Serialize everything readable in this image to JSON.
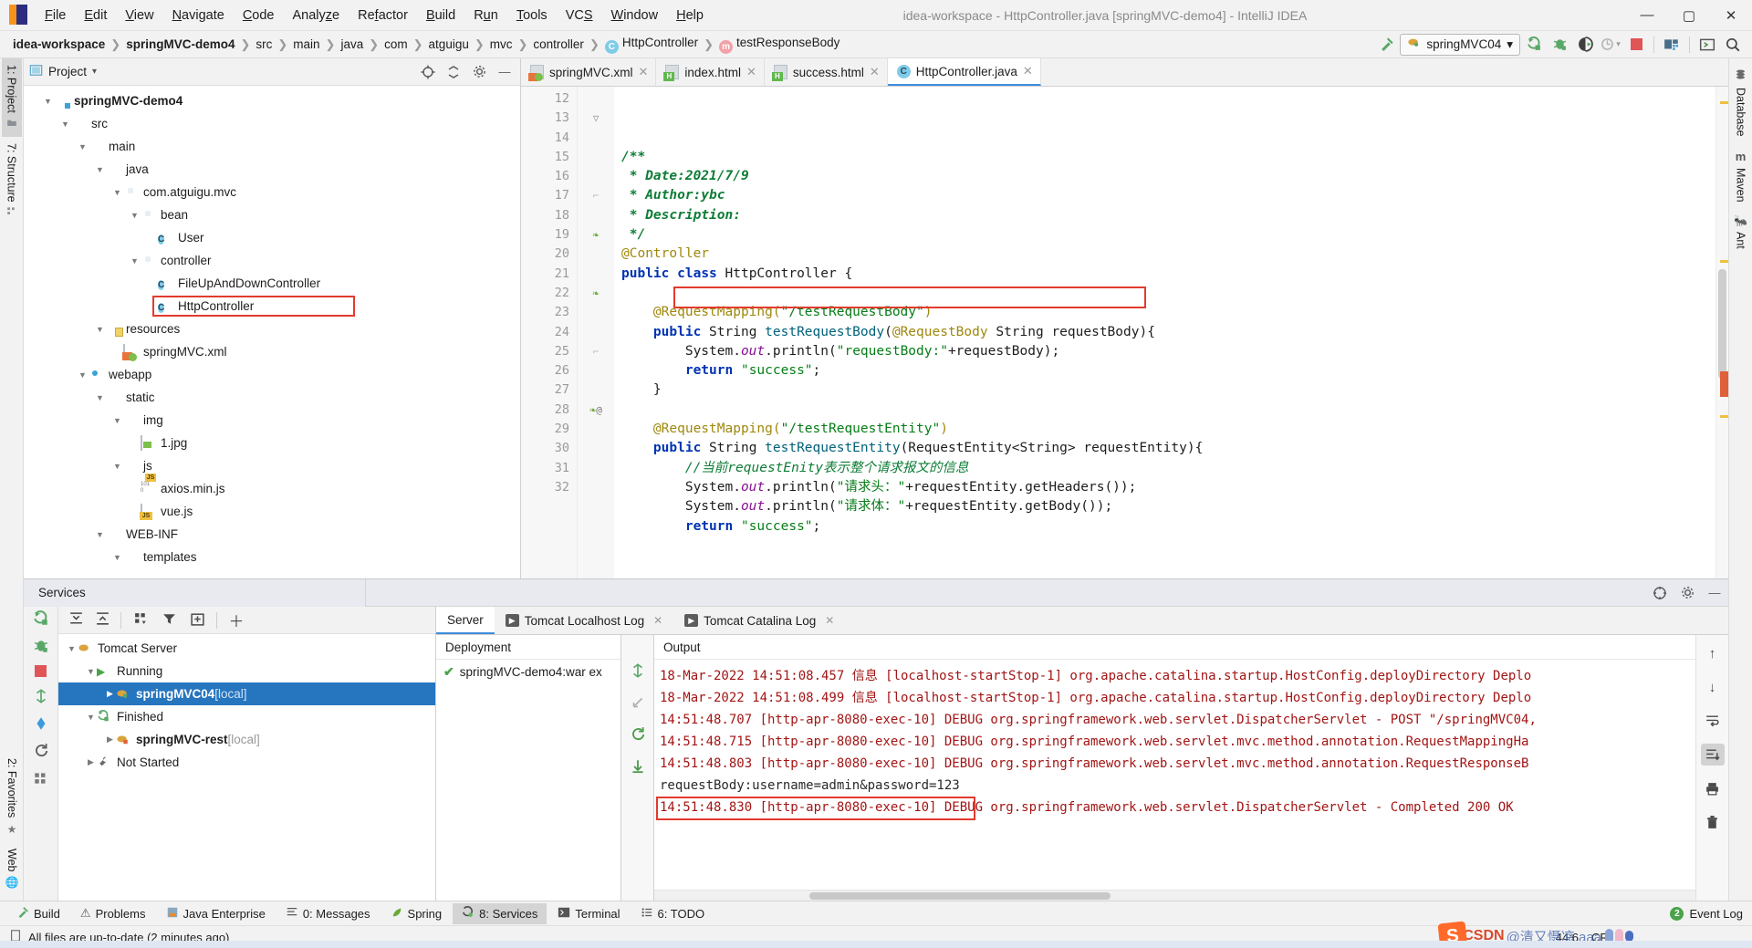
{
  "window": {
    "title": "idea-workspace - HttpController.java [springMVC-demo4] - IntelliJ IDEA",
    "minimize": "—",
    "maximize": "▢",
    "close": "✕"
  },
  "menubar": {
    "items": [
      "File",
      "Edit",
      "View",
      "Navigate",
      "Code",
      "Analyze",
      "Refactor",
      "Build",
      "Run",
      "Tools",
      "VCS",
      "Window",
      "Help"
    ]
  },
  "breadcrumb": {
    "items": [
      {
        "label": "idea-workspace",
        "bold": true,
        "icon": ""
      },
      {
        "label": "springMVC-demo4",
        "bold": true,
        "icon": ""
      },
      {
        "label": "src",
        "bold": false,
        "icon": ""
      },
      {
        "label": "main",
        "bold": false,
        "icon": ""
      },
      {
        "label": "java",
        "bold": false,
        "icon": ""
      },
      {
        "label": "com",
        "bold": false,
        "icon": ""
      },
      {
        "label": "atguigu",
        "bold": false,
        "icon": ""
      },
      {
        "label": "mvc",
        "bold": false,
        "icon": ""
      },
      {
        "label": "controller",
        "bold": false,
        "icon": ""
      },
      {
        "label": "HttpController",
        "bold": false,
        "icon": "C"
      },
      {
        "label": "testResponseBody",
        "bold": false,
        "icon": "m"
      }
    ],
    "separator": "〉"
  },
  "toolbar": {
    "run_config": "springMVC04",
    "dropdown_arrow": "▾",
    "icons": [
      "hammer-icon",
      "run-icon",
      "debug-icon",
      "run-coverage-icon",
      "profile-icon",
      "stop-icon",
      "project-structure-icon",
      "terminal-icon",
      "search-everywhere-icon"
    ]
  },
  "left_strip": {
    "tabs": [
      {
        "label": "1: Project",
        "active": true
      },
      {
        "label": "7: Structure",
        "active": false
      }
    ],
    "bottom_tabs": [
      {
        "label": "2: Favorites"
      },
      {
        "label": "Web"
      }
    ]
  },
  "right_strip": {
    "tabs": [
      "Database",
      "Maven",
      "Ant"
    ]
  },
  "project": {
    "header_title": "Project",
    "header_arrow": "▾",
    "tree": [
      {
        "depth": 0,
        "arrow": "▼",
        "icon": "module",
        "label": "springMVC-demo4",
        "bold": true,
        "boxed": false
      },
      {
        "depth": 1,
        "arrow": "▼",
        "icon": "folder",
        "label": "src",
        "bold": false,
        "boxed": false
      },
      {
        "depth": 2,
        "arrow": "▼",
        "icon": "folder",
        "label": "main",
        "bold": false,
        "boxed": false
      },
      {
        "depth": 3,
        "arrow": "▼",
        "icon": "folder-blue",
        "label": "java",
        "bold": false,
        "boxed": false
      },
      {
        "depth": 4,
        "arrow": "▼",
        "icon": "package",
        "label": "com.atguigu.mvc",
        "bold": false,
        "boxed": false
      },
      {
        "depth": 5,
        "arrow": "▼",
        "icon": "package",
        "label": "bean",
        "bold": false,
        "boxed": false
      },
      {
        "depth": 6,
        "arrow": "",
        "icon": "class",
        "label": "User",
        "bold": false,
        "boxed": false
      },
      {
        "depth": 5,
        "arrow": "▼",
        "icon": "package",
        "label": "controller",
        "bold": false,
        "boxed": false
      },
      {
        "depth": 6,
        "arrow": "",
        "icon": "class",
        "label": "FileUpAndDownController",
        "bold": false,
        "boxed": false
      },
      {
        "depth": 6,
        "arrow": "",
        "icon": "class",
        "label": "HttpController",
        "bold": false,
        "boxed": true
      },
      {
        "depth": 3,
        "arrow": "▼",
        "icon": "folder-res",
        "label": "resources",
        "bold": false,
        "boxed": false
      },
      {
        "depth": 4,
        "arrow": "",
        "icon": "xmlfile",
        "label": "springMVC.xml",
        "bold": false,
        "boxed": false
      },
      {
        "depth": 2,
        "arrow": "▼",
        "icon": "webapp",
        "label": "webapp",
        "bold": false,
        "boxed": false
      },
      {
        "depth": 3,
        "arrow": "▼",
        "icon": "folder",
        "label": "static",
        "bold": false,
        "boxed": false
      },
      {
        "depth": 4,
        "arrow": "▼",
        "icon": "folder",
        "label": "img",
        "bold": false,
        "boxed": false
      },
      {
        "depth": 5,
        "arrow": "",
        "icon": "imgfile",
        "label": "1.jpg",
        "bold": false,
        "boxed": false
      },
      {
        "depth": 4,
        "arrow": "▼",
        "icon": "folder",
        "label": "js",
        "bold": false,
        "boxed": false
      },
      {
        "depth": 5,
        "arrow": "",
        "icon": "jsmin",
        "label": "axios.min.js",
        "bold": false,
        "boxed": false
      },
      {
        "depth": 5,
        "arrow": "",
        "icon": "jsfile",
        "label": "vue.js",
        "bold": false,
        "boxed": false
      },
      {
        "depth": 3,
        "arrow": "▼",
        "icon": "folder",
        "label": "WEB-INF",
        "bold": false,
        "boxed": false
      },
      {
        "depth": 4,
        "arrow": "▼",
        "icon": "folder",
        "label": "templates",
        "bold": false,
        "boxed": false
      }
    ]
  },
  "editor": {
    "tabs": [
      {
        "label": "springMVC.xml",
        "icon": "xml",
        "active": false,
        "close": "✕"
      },
      {
        "label": "index.html",
        "icon": "html",
        "active": false,
        "close": "✕"
      },
      {
        "label": "success.html",
        "icon": "html",
        "active": false,
        "close": "✕"
      },
      {
        "label": "HttpController.java",
        "icon": "java",
        "active": true,
        "close": "✕"
      }
    ],
    "first_line_number": 12,
    "lines": [
      {
        "n": 12,
        "mark": "",
        "tokens": []
      },
      {
        "n": 13,
        "mark": "fold-doc",
        "tokens": [
          {
            "t": "/**",
            "c": "jd"
          }
        ]
      },
      {
        "n": 14,
        "mark": "",
        "tokens": [
          {
            "t": " * Date:2021/7/9",
            "c": "jd"
          }
        ]
      },
      {
        "n": 15,
        "mark": "",
        "tokens": [
          {
            "t": " * Author:ybc",
            "c": "jd"
          }
        ]
      },
      {
        "n": 16,
        "mark": "",
        "tokens": [
          {
            "t": " * Description:",
            "c": "jd"
          }
        ]
      },
      {
        "n": 17,
        "mark": "fold-end",
        "tokens": [
          {
            "t": " */",
            "c": "jd"
          }
        ]
      },
      {
        "n": 18,
        "mark": "",
        "tokens": [
          {
            "t": "@Controller",
            "c": "ann"
          }
        ]
      },
      {
        "n": 19,
        "mark": "bean",
        "tokens": [
          {
            "t": "public",
            "c": "k"
          },
          {
            "t": " ",
            "c": "plain"
          },
          {
            "t": "class",
            "c": "k"
          },
          {
            "t": " HttpController {",
            "c": "plain"
          }
        ]
      },
      {
        "n": 20,
        "mark": "",
        "tokens": []
      },
      {
        "n": 21,
        "mark": "",
        "tokens": [
          {
            "t": "    @RequestMapping(",
            "c": "ann"
          },
          {
            "t": "\"/testRequestBody\"",
            "c": "str"
          },
          {
            "t": ")",
            "c": "ann"
          }
        ]
      },
      {
        "n": 22,
        "mark": "bean",
        "tokens": [
          {
            "t": "    ",
            "c": "plain"
          },
          {
            "t": "public",
            "c": "k"
          },
          {
            "t": " String ",
            "c": "plain"
          },
          {
            "t": "testRequestBody",
            "c": "mth"
          },
          {
            "t": "(",
            "c": "plain"
          },
          {
            "t": "@RequestBody",
            "c": "ann"
          },
          {
            "t": " String requestBody){",
            "c": "plain"
          }
        ]
      },
      {
        "n": 23,
        "mark": "",
        "tokens": [
          {
            "t": "        System.",
            "c": "plain"
          },
          {
            "t": "out",
            "c": "fld"
          },
          {
            "t": ".println(",
            "c": "plain"
          },
          {
            "t": "\"requestBody:\"",
            "c": "str"
          },
          {
            "t": "+requestBody);",
            "c": "plain"
          }
        ]
      },
      {
        "n": 24,
        "mark": "",
        "tokens": [
          {
            "t": "        ",
            "c": "plain"
          },
          {
            "t": "return",
            "c": "k"
          },
          {
            "t": " ",
            "c": "plain"
          },
          {
            "t": "\"success\"",
            "c": "str"
          },
          {
            "t": ";",
            "c": "plain"
          }
        ]
      },
      {
        "n": 25,
        "mark": "fold-end",
        "tokens": [
          {
            "t": "    }",
            "c": "plain"
          }
        ]
      },
      {
        "n": 26,
        "mark": "",
        "tokens": []
      },
      {
        "n": 27,
        "mark": "",
        "tokens": [
          {
            "t": "    @RequestMapping(",
            "c": "ann"
          },
          {
            "t": "\"/testRequestEntity\"",
            "c": "str"
          },
          {
            "t": ")",
            "c": "ann"
          }
        ]
      },
      {
        "n": 28,
        "mark": "bean-at",
        "tokens": [
          {
            "t": "    ",
            "c": "plain"
          },
          {
            "t": "public",
            "c": "k"
          },
          {
            "t": " String ",
            "c": "plain"
          },
          {
            "t": "testRequestEntity",
            "c": "mth"
          },
          {
            "t": "(RequestEntity<String> requestEntity){",
            "c": "plain"
          }
        ]
      },
      {
        "n": 29,
        "mark": "",
        "tokens": [
          {
            "t": "        //当前requestEnity表示整个请求报文的信息",
            "c": "cmzh"
          }
        ]
      },
      {
        "n": 30,
        "mark": "",
        "tokens": [
          {
            "t": "        System.",
            "c": "plain"
          },
          {
            "t": "out",
            "c": "fld"
          },
          {
            "t": ".println(",
            "c": "plain"
          },
          {
            "t": "\"请求头：\"",
            "c": "str"
          },
          {
            "t": "+requestEntity.getHeaders());",
            "c": "plain"
          }
        ]
      },
      {
        "n": 31,
        "mark": "",
        "tokens": [
          {
            "t": "        System.",
            "c": "plain"
          },
          {
            "t": "out",
            "c": "fld"
          },
          {
            "t": ".println(",
            "c": "plain"
          },
          {
            "t": "\"请求体：\"",
            "c": "str"
          },
          {
            "t": "+requestEntity.getBody());",
            "c": "plain"
          }
        ]
      },
      {
        "n": 32,
        "mark": "",
        "tokens": [
          {
            "t": "        ",
            "c": "plain"
          },
          {
            "t": "return",
            "c": "k"
          },
          {
            "t": " ",
            "c": "plain"
          },
          {
            "t": "\"success\"",
            "c": "str"
          },
          {
            "t": ";",
            "c": "plain"
          }
        ]
      }
    ],
    "highlight_note": "red box around line 23 println statement"
  },
  "services": {
    "panel_title": "Services",
    "tree": [
      {
        "depth": 0,
        "arrow": "▼",
        "icon": "tomcat",
        "label": "Tomcat Server",
        "suffix": "",
        "bold": false,
        "selected": false
      },
      {
        "depth": 1,
        "arrow": "▼",
        "icon": "running",
        "label": "Running",
        "suffix": "",
        "bold": false,
        "selected": false
      },
      {
        "depth": 2,
        "arrow": "▶",
        "icon": "tomcat-run",
        "label": "springMVC04",
        "suffix": " [local]",
        "bold": true,
        "selected": true
      },
      {
        "depth": 1,
        "arrow": "▼",
        "icon": "finished",
        "label": "Finished",
        "suffix": "",
        "bold": false,
        "selected": false
      },
      {
        "depth": 2,
        "arrow": "▶",
        "icon": "tomcat-stop",
        "label": "springMVC-rest",
        "suffix": " [local]",
        "bold": true,
        "selected": false
      },
      {
        "depth": 1,
        "arrow": "▶",
        "icon": "wrench",
        "label": "Not Started",
        "suffix": "",
        "bold": false,
        "selected": false
      }
    ],
    "console_tabs": [
      {
        "label": "Server",
        "active": true,
        "has_icon": false,
        "close": ""
      },
      {
        "label": "Tomcat Localhost Log",
        "active": false,
        "has_icon": true,
        "close": "✕"
      },
      {
        "label": "Tomcat Catalina Log",
        "active": false,
        "has_icon": true,
        "close": "✕"
      }
    ],
    "deployment": {
      "header": "Deployment",
      "rows": [
        {
          "label": "springMVC-demo4:war ex",
          "status": "✔"
        }
      ]
    },
    "output": {
      "header": "Output",
      "lines": [
        {
          "text": "18-Mar-2022 14:51:08.457 信息 [localhost-startStop-1] org.apache.catalina.startup.HostConfig.deployDirectory Deplo",
          "style": "red",
          "boxed": false
        },
        {
          "text": "18-Mar-2022 14:51:08.499 信息 [localhost-startStop-1] org.apache.catalina.startup.HostConfig.deployDirectory Deplo",
          "style": "red",
          "boxed": false
        },
        {
          "text": "14:51:48.707 [http-apr-8080-exec-10] DEBUG org.springframework.web.servlet.DispatcherServlet - POST \"/springMVC04,",
          "style": "red",
          "boxed": false
        },
        {
          "text": "14:51:48.715 [http-apr-8080-exec-10] DEBUG org.springframework.web.servlet.mvc.method.annotation.RequestMappingHa",
          "style": "red",
          "boxed": false
        },
        {
          "text": "14:51:48.803 [http-apr-8080-exec-10] DEBUG org.springframework.web.servlet.mvc.method.annotation.RequestResponseB",
          "style": "red",
          "boxed": false
        },
        {
          "text": "requestBody:username=admin&password=123",
          "style": "plain",
          "boxed": true
        },
        {
          "text": "14:51:48.830 [http-apr-8080-exec-10] DEBUG org.springframework.web.servlet.DispatcherServlet - Completed 200 OK",
          "style": "red",
          "boxed": false
        }
      ]
    }
  },
  "bottom_bar": {
    "buttons": [
      {
        "label": "Build",
        "icon": "hammer-icon",
        "active": false
      },
      {
        "label": "Problems",
        "icon": "warning-icon",
        "active": false
      },
      {
        "label": "Java Enterprise",
        "icon": "java-ee-icon",
        "active": false
      },
      {
        "label": "0: Messages",
        "icon": "messages-icon",
        "active": false
      },
      {
        "label": "Spring",
        "icon": "spring-leaf-icon",
        "active": false
      },
      {
        "label": "8: Services",
        "icon": "services-icon",
        "active": true
      },
      {
        "label": "Terminal",
        "icon": "terminal-icon",
        "active": false
      },
      {
        "label": "6: TODO",
        "icon": "todo-icon",
        "active": false
      }
    ],
    "event_log": {
      "label": "Event Log",
      "count": "2"
    }
  },
  "status_bar": {
    "message": "All files are up-to-date (2 minutes ago)",
    "caret": "44:6",
    "line_sep": "CRLF"
  },
  "watermark": {
    "brand": "CSDN",
    "handle": "@清又慑凉 aaa",
    "mark": "S"
  },
  "colors": {
    "accent_blue": "#2675bf",
    "highlight_red": "#e23b2e",
    "log_red": "#a31515",
    "keyword_blue": "#0033b3",
    "string_green": "#067d17",
    "annotation_gold": "#9e880d",
    "field_purple": "#871094",
    "method_teal": "#00627a",
    "panel_bg": "#f2f2f2"
  }
}
